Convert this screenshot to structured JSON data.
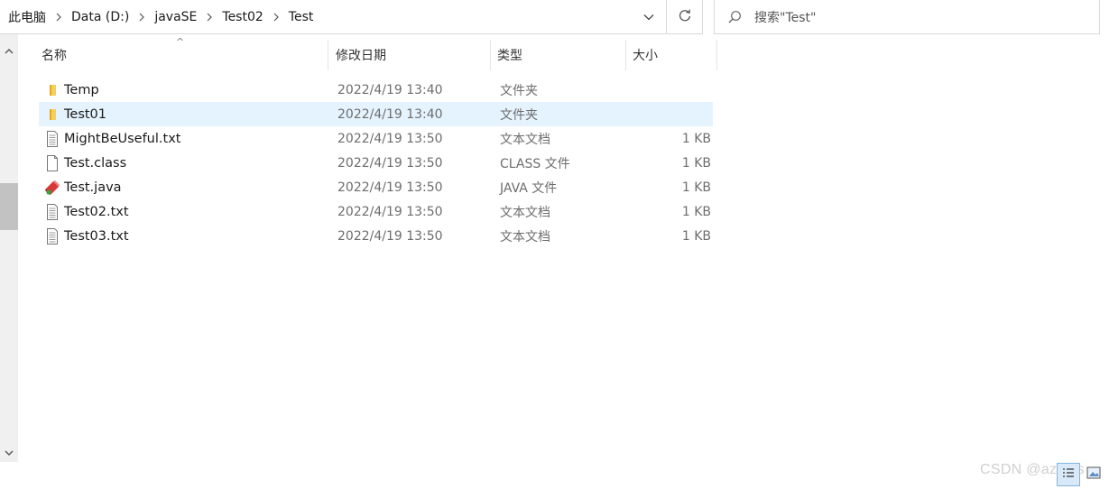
{
  "address_bar": {
    "breadcrumbs": [
      "此电脑",
      "Data (D:)",
      "javaSE",
      "Test02",
      "Test"
    ]
  },
  "search": {
    "placeholder": "搜索\"Test\""
  },
  "columns": {
    "name": "名称",
    "date": "修改日期",
    "type": "类型",
    "size": "大小"
  },
  "files": [
    {
      "name": "Temp",
      "date": "2022/4/19 13:40",
      "type": "文件夹",
      "size": "",
      "icon": "folder-icon"
    },
    {
      "name": "Test01",
      "date": "2022/4/19 13:40",
      "type": "文件夹",
      "size": "",
      "icon": "folder-icon"
    },
    {
      "name": "MightBeUseful.txt",
      "date": "2022/4/19 13:50",
      "type": "文本文档",
      "size": "1 KB",
      "icon": "text-file-icon"
    },
    {
      "name": "Test.class",
      "date": "2022/4/19 13:50",
      "type": "CLASS 文件",
      "size": "1 KB",
      "icon": "blank-file-icon"
    },
    {
      "name": "Test.java",
      "date": "2022/4/19 13:50",
      "type": "JAVA 文件",
      "size": "1 KB",
      "icon": "java-file-icon"
    },
    {
      "name": "Test02.txt",
      "date": "2022/4/19 13:50",
      "type": "文本文档",
      "size": "1 KB",
      "icon": "text-file-icon"
    },
    {
      "name": "Test03.txt",
      "date": "2022/4/19 13:50",
      "type": "文本文档",
      "size": "1 KB",
      "icon": "text-file-icon"
    }
  ],
  "selected_row": 1,
  "watermark": "CSDN @azplus",
  "colors": {
    "selection": "#e5f3ff",
    "folder": "#f4c542",
    "border": "#d9d9d9"
  }
}
